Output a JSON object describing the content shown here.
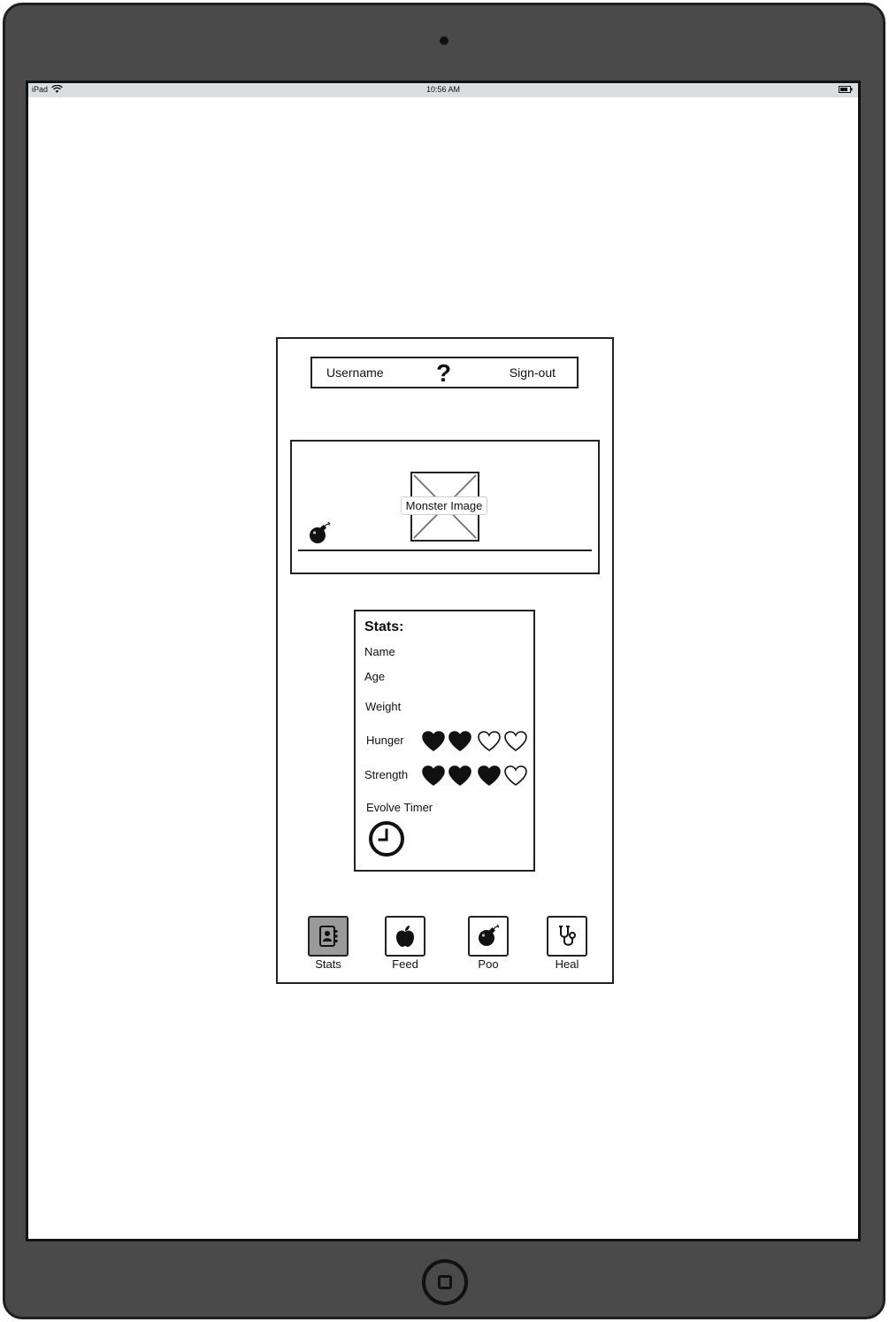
{
  "status_bar": {
    "device": "iPad",
    "time": "10:56 AM"
  },
  "header": {
    "username": "Username",
    "help": "?",
    "signout": "Sign-out"
  },
  "monster": {
    "image_label": "Monster Image"
  },
  "stats": {
    "title": "Stats:",
    "name_label": "Name",
    "age_label": "Age",
    "weight_label": "Weight",
    "hunger_label": "Hunger",
    "hunger_level": 2,
    "hunger_max": 4,
    "strength_label": "Strength",
    "strength_level": 3,
    "strength_max": 4,
    "evolve_label": "Evolve Timer"
  },
  "nav": [
    {
      "label": "Stats",
      "icon": "contacts-icon",
      "active": true
    },
    {
      "label": "Feed",
      "icon": "apple-icon",
      "active": false
    },
    {
      "label": "Poo",
      "icon": "bomb-icon",
      "active": false
    },
    {
      "label": "Heal",
      "icon": "stethoscope-icon",
      "active": false
    }
  ]
}
